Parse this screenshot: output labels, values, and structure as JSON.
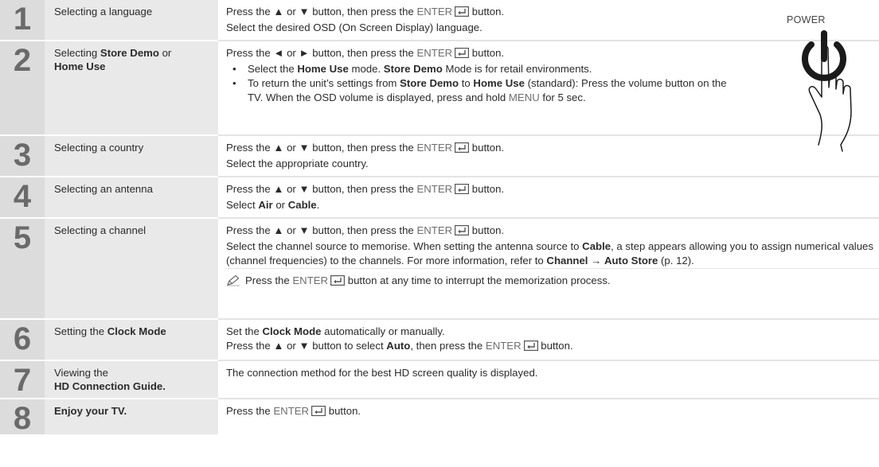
{
  "power_label": "POWER",
  "enter_word": "ENTER",
  "steps": [
    {
      "n": "1",
      "title": [
        "Selecting a language"
      ],
      "lines": [
        [
          "Press the ▲ or ▼ button, then press the ",
          "ENTER",
          " button."
        ],
        [
          "Select the desired OSD (On Screen Display) language."
        ]
      ]
    },
    {
      "n": "2",
      "title": [
        "Selecting ",
        "Store Demo",
        " or",
        "Home Use"
      ],
      "intro": [
        "Press the ◄ or ► button, then press the ",
        "ENTER",
        " button."
      ],
      "bullets": [
        [
          "Select the ",
          "Home Use",
          " mode. ",
          "Store Demo",
          " Mode is for retail environments."
        ],
        [
          "To return the unit’s settings from ",
          "Store Demo",
          " to ",
          "Home Use",
          " (standard): Press the volume button on the TV. When the OSD volume is displayed, press and hold ",
          "MENU",
          " for 5 sec."
        ]
      ]
    },
    {
      "n": "3",
      "title": [
        "Selecting a country"
      ],
      "lines": [
        [
          "Press the ▲ or ▼ button, then press the ",
          "ENTER",
          " button."
        ],
        [
          "Select the appropriate country."
        ]
      ]
    },
    {
      "n": "4",
      "title": [
        "Selecting an antenna"
      ],
      "lines": [
        [
          "Press the ▲ or ▼ button, then press the ",
          "ENTER",
          " button."
        ],
        [
          "Select ",
          "Air",
          " or ",
          "Cable",
          "."
        ]
      ]
    },
    {
      "n": "5",
      "title": [
        "Selecting a channel"
      ],
      "lines": [
        [
          "Press the ▲ or ▼ button, then press the ",
          "ENTER",
          " button."
        ],
        [
          "Select the channel source to memorise. When setting the antenna source to ",
          "Cable",
          ", a step appears allowing you to assign numerical values (channel frequencies) to the channels. For more information, refer to ",
          "Channel →",
          " ",
          "Auto Store",
          " (p. 12)."
        ]
      ],
      "note": [
        "Press the ",
        "ENTER",
        " button at any time to interrupt the memorization process."
      ]
    },
    {
      "n": "6",
      "title": [
        "Setting the ",
        "Clock Mode"
      ],
      "lines": [
        [
          "Set the ",
          "Clock Mode",
          " automatically or manually."
        ],
        [
          "Press the ▲ or ▼ button to select ",
          "Auto",
          ", then press the ",
          "ENTER",
          " button."
        ]
      ]
    },
    {
      "n": "7",
      "title": [
        "Viewing the",
        "HD Connection Guide."
      ],
      "lines": [
        [
          "The connection method for the best HD screen quality is displayed."
        ]
      ]
    },
    {
      "n": "8",
      "title": [
        "Enjoy your TV."
      ],
      "lines": [
        [
          "Press the ",
          "ENTER",
          " button."
        ]
      ]
    }
  ]
}
